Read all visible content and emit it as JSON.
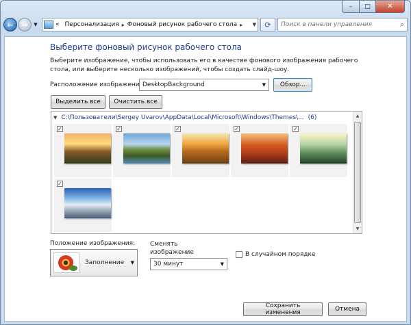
{
  "window": {
    "caption": {
      "minimize": "–",
      "maximize": "□",
      "close": "✕"
    }
  },
  "nav": {
    "back_glyph": "←",
    "forward_glyph": "→",
    "breadcrumb_prefix": "«",
    "breadcrumb": [
      "Персонализация",
      "Фоновый рисунок рабочего стола"
    ],
    "breadcrumb_separator": "▸",
    "search_placeholder": "Поиск в панели управления"
  },
  "page": {
    "title": "Выберите фоновый рисунок рабочего стола",
    "description": "Выберите изображение, чтобы использовать его в качестве фонового изображения рабочего стола, или выберите несколько изображений, чтобы создать слайд-шоу.",
    "location_label": "Расположение изображения:",
    "location_value": "DesktopBackground",
    "browse_label": "Обзор...",
    "select_all_label": "Выделить все",
    "clear_all_label": "Очистить все"
  },
  "gallery": {
    "group_path": "C:\\Пользователи\\Sergey Uvarov\\AppData\\Local\\Microsoft\\Windows\\Themes\\...",
    "group_count": "(6)",
    "check_glyph": "✓",
    "items": [
      {
        "name": "sunrise-rocks",
        "checked": true
      },
      {
        "name": "green-valley-stream",
        "checked": true
      },
      {
        "name": "autumn-tree-field",
        "checked": true
      },
      {
        "name": "red-canyon",
        "checked": true
      },
      {
        "name": "misty-forest",
        "checked": true
      },
      {
        "name": "snow-mountains",
        "checked": true
      }
    ]
  },
  "settings": {
    "position_label": "Положение изображения:",
    "position_value": "Заполнение",
    "change_label": "Сменять изображение каждые:",
    "change_value": "30 минут",
    "shuffle_label": "В случайном порядке",
    "shuffle_checked": false
  },
  "footer": {
    "save_label": "Сохранить изменения",
    "cancel_label": "Отмена"
  },
  "colors": {
    "title_blue": "#1e3c87",
    "window_frame": "#c9dcef"
  }
}
